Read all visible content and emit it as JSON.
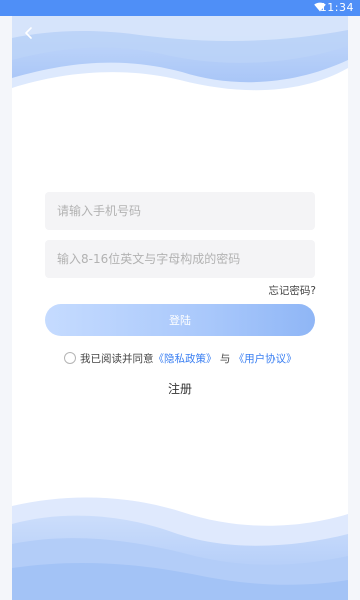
{
  "status_bar": {
    "time": "11:34",
    "wifi_icon": "wifi-icon"
  },
  "header": {
    "back_icon": "chevron-left-icon"
  },
  "form": {
    "phone_placeholder": "请输入手机号码",
    "password_placeholder": "输入8-16位英文与字母构成的密码",
    "forgot_label": "忘记密码?",
    "login_label": "登陆"
  },
  "agreement": {
    "prefix": "我已阅读并同意",
    "privacy_link": "《隐私政策》",
    "connector": "与",
    "terms_link": "《用户协议》"
  },
  "register_label": "注册",
  "colors": {
    "accent": "#4f8ff7",
    "link": "#3a7ff2",
    "button_gradient_start": "#c5dbff",
    "button_gradient_end": "#8fb6f6"
  }
}
